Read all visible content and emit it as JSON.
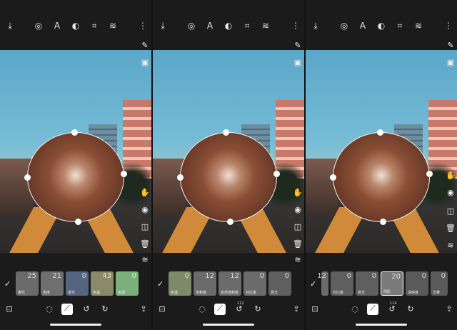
{
  "toolbar_icons": [
    "download-icon",
    "palette-icon",
    "text-icon",
    "mask-icon",
    "crop-icon",
    "layers-icon",
    "more-icon"
  ],
  "panels": [
    {
      "chips": [
        {
          "value": "25",
          "name": "曝光",
          "color": "#6b6b6b"
        },
        {
          "value": "21",
          "name": "亮度",
          "color": "#6f6f6f"
        },
        {
          "value": "0",
          "name": "遮光",
          "color": "#55657f"
        },
        {
          "value": "43",
          "name": "色温",
          "color": "#8a8a6a"
        },
        {
          "value": "0",
          "name": "色调",
          "color": "#7bb07b"
        },
        {
          "value": "",
          "name": "",
          "color": "#9a7a9a"
        }
      ],
      "version_badge": ""
    },
    {
      "chips": [
        {
          "value": "0",
          "name": "色温",
          "color": "#7c8a6a"
        },
        {
          "value": "12",
          "name": "饱和度",
          "color": "#6b6b6b"
        },
        {
          "value": "12",
          "name": "自然饱和度",
          "color": "#6b6b6b"
        },
        {
          "value": "0",
          "name": "对比度",
          "color": "#6b6b6b"
        },
        {
          "value": "0",
          "name": "高光",
          "color": "#5f5f5f"
        },
        {
          "value": "",
          "name": "阴影",
          "color": "#5a5a5a"
        }
      ],
      "version_badge": "112"
    },
    {
      "chips": [
        {
          "value": "12",
          "name": "饱和度",
          "color": "#6b6b6b"
        },
        {
          "value": "0",
          "name": "对比度",
          "color": "#5f5f5f"
        },
        {
          "value": "0",
          "name": "高光",
          "color": "#5f5f5f"
        },
        {
          "value": "20",
          "name": "阴影",
          "color": "#7a7a7a"
        },
        {
          "value": "0",
          "name": "清晰度",
          "color": "#5a5a5a"
        },
        {
          "value": "0",
          "name": "去雾",
          "color": "#5a5a5a"
        }
      ],
      "version_badge": "114",
      "slider_value": 0.75
    }
  ]
}
